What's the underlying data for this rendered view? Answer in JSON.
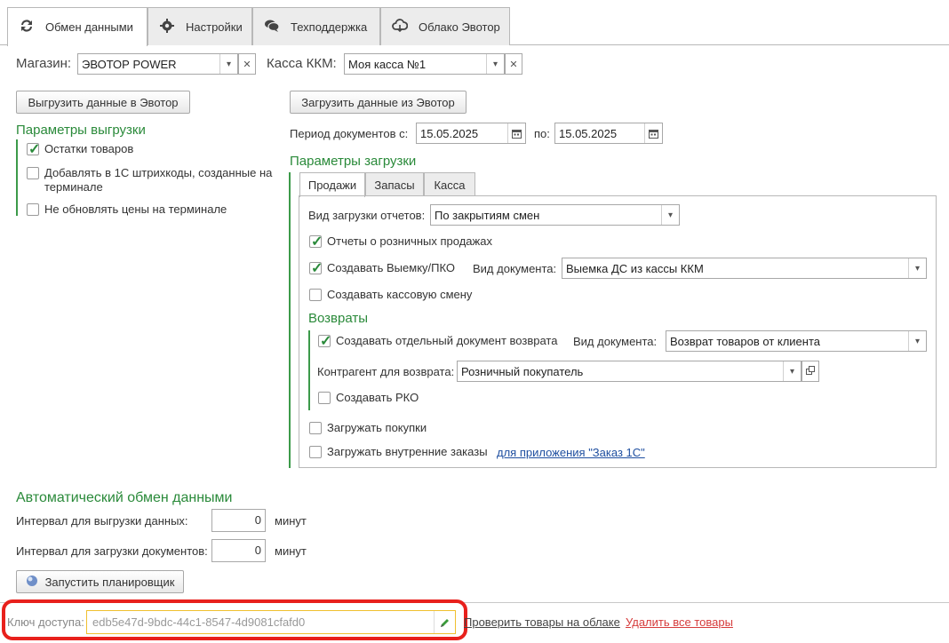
{
  "tabs": [
    {
      "label": "Обмен данными",
      "icon": "sync-icon",
      "active": true
    },
    {
      "label": "Настройки",
      "icon": "gear-icon"
    },
    {
      "label": "Техподдержка",
      "icon": "chat-icon"
    },
    {
      "label": "Облако Эвотор",
      "icon": "cloud-icon"
    }
  ],
  "store": {
    "label": "Магазин:",
    "value": "ЭВОТОР POWER"
  },
  "register": {
    "label": "Касса ККМ:",
    "value": "Моя касса №1"
  },
  "export": {
    "button": "Выгрузить данные в Эвотор",
    "title": "Параметры выгрузки",
    "options": [
      {
        "label": "Остатки товаров",
        "checked": true
      },
      {
        "label1": "Добавлять в 1С штрихкоды, созданные на",
        "label2": "терминале",
        "checked": false
      },
      {
        "label": "Не обновлять цены на терминале",
        "checked": false
      }
    ]
  },
  "import": {
    "button": "Загрузить данные из Эвотор",
    "period_label": "Период  документов с:",
    "date_from": "15.05.2025",
    "to_label": "по:",
    "date_to": "15.05.2025",
    "title": "Параметры загрузки",
    "tabs": [
      "Продажи",
      "Запасы",
      "Касса"
    ],
    "report_type_label": "Вид загрузки отчетов:",
    "report_type_value": "По закрытиям смен",
    "retail_reports": "Отчеты о розничных продажах",
    "create_withdrawal": "Создавать Выемку/ПКО",
    "doc_type_label": "Вид документа:",
    "doc_type_value": "Выемка ДС из кассы ККМ",
    "create_shift": "Создавать кассовую смену",
    "returns_title": "Возвраты",
    "separate_return": "Создавать отдельный документ возврата",
    "return_doc_label": "Вид  документа:",
    "return_doc_value": "Возврат товаров от клиента",
    "counterparty_label": "Контрагент для возврата:",
    "counterparty_value": "Розничный покупатель",
    "create_rko": "Создавать РКО",
    "load_purchases": "Загружать покупки",
    "load_orders": "Загружать внутренние заказы",
    "orders_link": "для приложения \"Заказ 1С\""
  },
  "auto": {
    "title": "Автоматический обмен данными",
    "export_interval_label": "Интервал для выгрузки данных:",
    "export_interval_value": "0",
    "import_interval_label": "Интервал для загрузки документов:",
    "import_interval_value": "0",
    "unit": "минут",
    "scheduler_button": "Запустить планировщик"
  },
  "footer": {
    "key_label": "Ключ доступа:",
    "key_value": "edb5e47d-9bdc-44c1-8547-4d9081cfafd0",
    "check_link": "Проверить товары на облаке",
    "delete_link": "Удалить все товары"
  },
  "colors": {
    "accent_green": "#2a8a3a",
    "highlight_red": "#e8201c",
    "link_blue": "#1f4fa0",
    "delete_red": "#d63c3c"
  }
}
